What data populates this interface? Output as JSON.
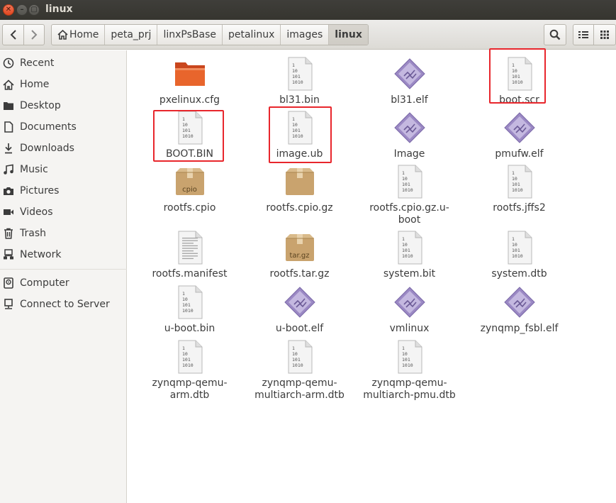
{
  "window": {
    "title": "linux"
  },
  "toolbar": {
    "back_icon": "chevron-left-icon",
    "forward_icon": "chevron-right-icon",
    "breadcrumbs": [
      "Home",
      "peta_prj",
      "linxPsBase",
      "petalinux",
      "images",
      "linux"
    ]
  },
  "sidebar": {
    "items": [
      {
        "label": "Recent",
        "icon": "clock-icon"
      },
      {
        "label": "Home",
        "icon": "home-icon"
      },
      {
        "label": "Desktop",
        "icon": "folder-icon"
      },
      {
        "label": "Documents",
        "icon": "document-icon"
      },
      {
        "label": "Downloads",
        "icon": "download-icon"
      },
      {
        "label": "Music",
        "icon": "music-icon"
      },
      {
        "label": "Pictures",
        "icon": "camera-icon"
      },
      {
        "label": "Videos",
        "icon": "video-icon"
      },
      {
        "label": "Trash",
        "icon": "trash-icon"
      },
      {
        "label": "Network",
        "icon": "network-icon"
      },
      {
        "label": "Computer",
        "icon": "computer-icon"
      },
      {
        "label": "Connect to Server",
        "icon": "server-icon"
      }
    ]
  },
  "files": [
    {
      "name": "pxelinux.cfg",
      "icon": "folder"
    },
    {
      "name": "bl31.bin",
      "icon": "binary"
    },
    {
      "name": "bl31.elf",
      "icon": "executable"
    },
    {
      "name": "boot.scr",
      "icon": "binary"
    },
    {
      "name": "BOOT.BIN",
      "icon": "binary"
    },
    {
      "name": "image.ub",
      "icon": "binary"
    },
    {
      "name": "Image",
      "icon": "executable"
    },
    {
      "name": "pmufw.elf",
      "icon": "executable"
    },
    {
      "name": "rootfs.cpio",
      "icon": "archive",
      "badge": "cpio"
    },
    {
      "name": "rootfs.cpio.gz",
      "icon": "archive"
    },
    {
      "name": "rootfs.cpio.gz.u-boot",
      "icon": "binary"
    },
    {
      "name": "rootfs.jffs2",
      "icon": "binary"
    },
    {
      "name": "rootfs.manifest",
      "icon": "text"
    },
    {
      "name": "rootfs.tar.gz",
      "icon": "archive",
      "badge": "tar.gz"
    },
    {
      "name": "system.bit",
      "icon": "binary"
    },
    {
      "name": "system.dtb",
      "icon": "binary"
    },
    {
      "name": "u-boot.bin",
      "icon": "binary"
    },
    {
      "name": "u-boot.elf",
      "icon": "executable"
    },
    {
      "name": "vmlinux",
      "icon": "executable"
    },
    {
      "name": "zynqmp_fsbl.elf",
      "icon": "executable"
    },
    {
      "name": "zynqmp-qemu-arm.dtb",
      "icon": "binary"
    },
    {
      "name": "zynqmp-qemu-multiarch-arm.dtb",
      "icon": "binary"
    },
    {
      "name": "zynqmp-qemu-multiarch-pmu.dtb",
      "icon": "binary"
    }
  ],
  "binary_icon_lines": [
    "1",
    "10",
    "101",
    "1010"
  ],
  "colors": {
    "highlight": "#e8262c",
    "folder": "#e8652c",
    "archive": "#c9a36e",
    "executable": "#9b89c4"
  }
}
